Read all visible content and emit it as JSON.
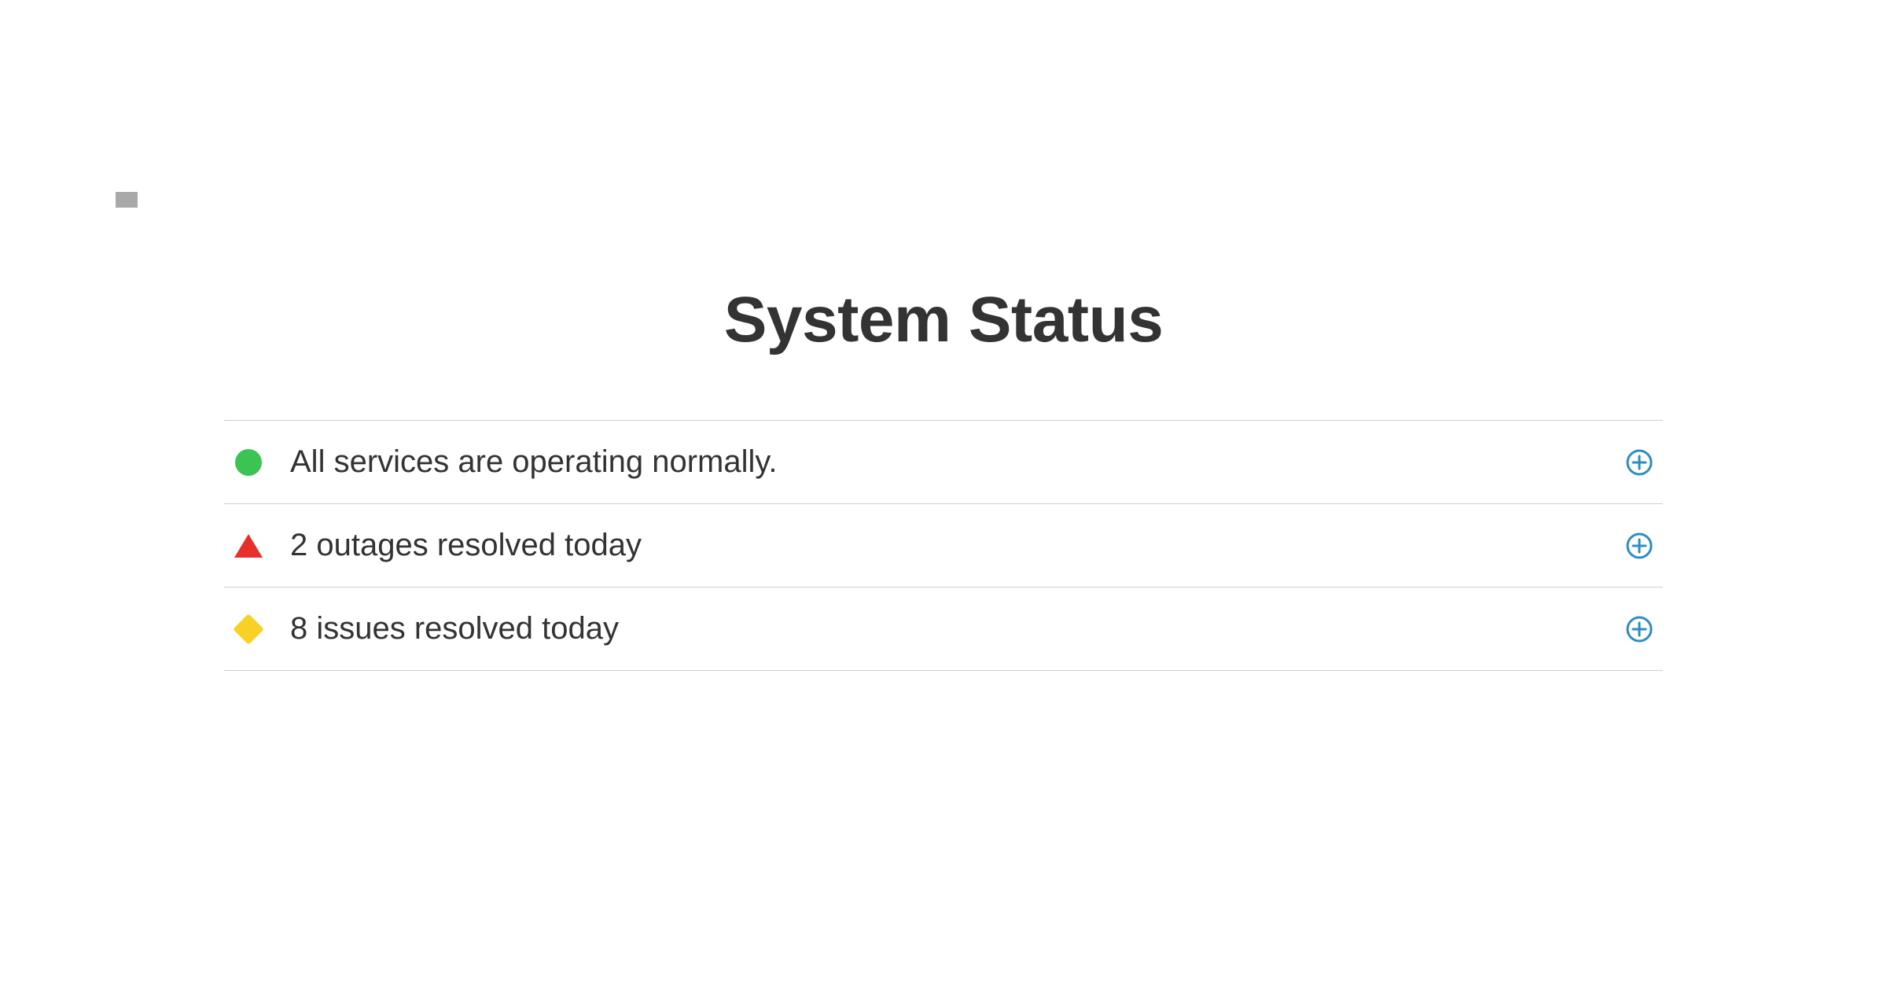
{
  "page": {
    "title": "System Status"
  },
  "status_items": [
    {
      "icon": "circle-green",
      "message": "All services are operating normally."
    },
    {
      "icon": "triangle-red",
      "message": "2 outages resolved today"
    },
    {
      "icon": "diamond-yellow",
      "message": "8 issues resolved today"
    }
  ],
  "colors": {
    "green": "#3BC453",
    "red": "#E73029",
    "yellow": "#F9D126",
    "blue": "#2F8DC5"
  }
}
